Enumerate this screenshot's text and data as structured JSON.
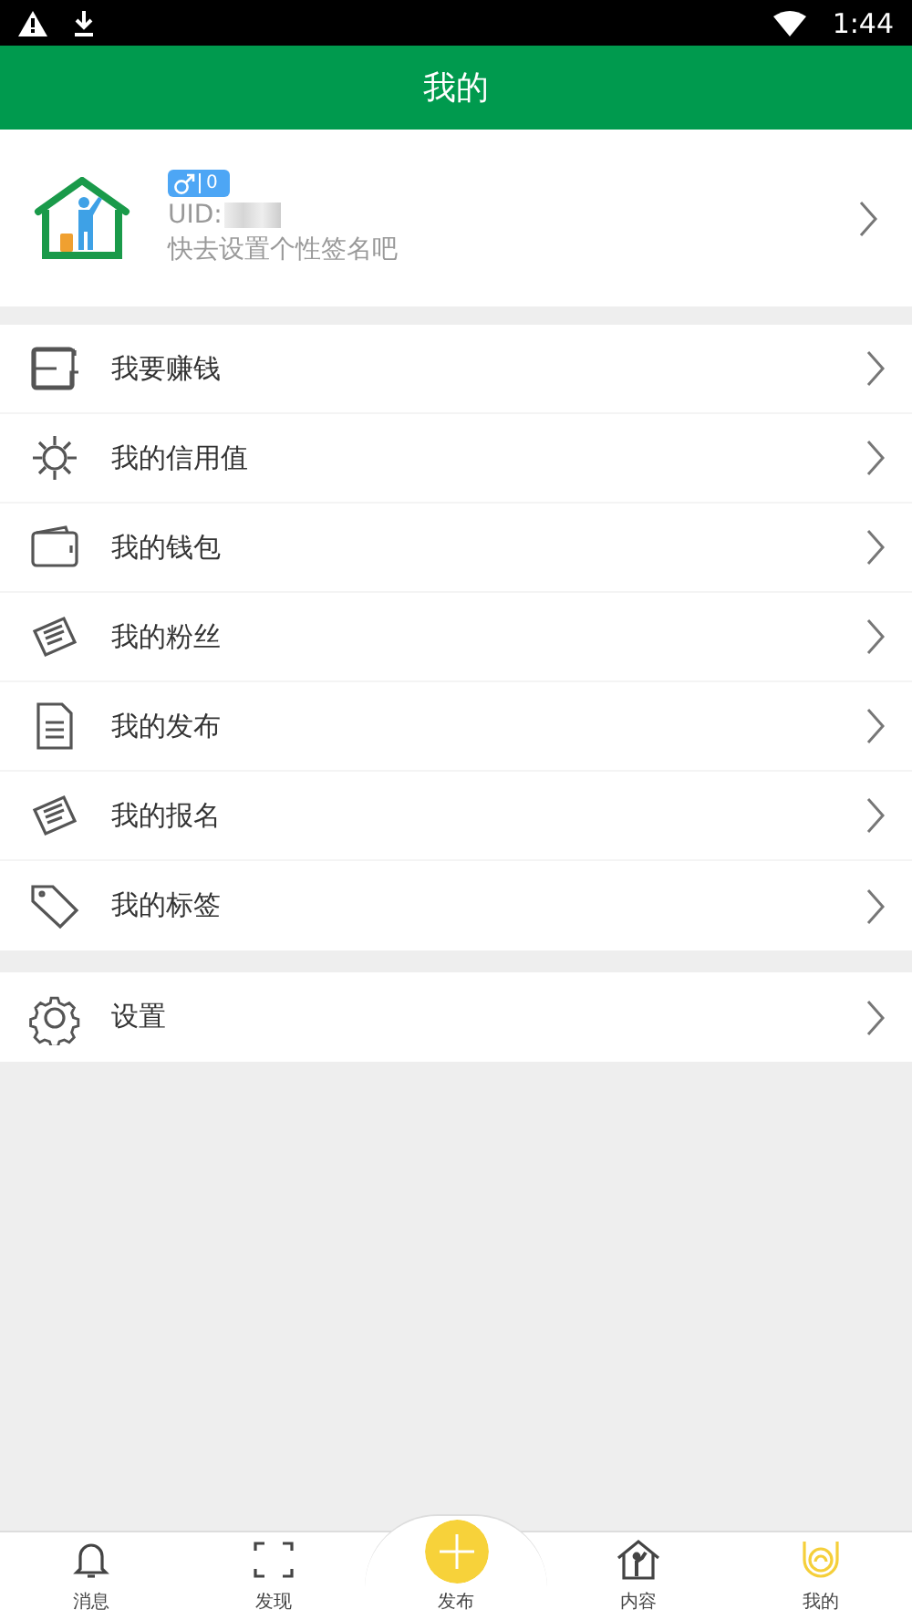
{
  "status_bar": {
    "time": "1:44"
  },
  "header": {
    "title": "我的"
  },
  "profile": {
    "badge_count": "0",
    "uid_label": "UID:",
    "signature": "快去设置个性签名吧"
  },
  "menu_sections": [
    [
      {
        "kind": "card",
        "label": "我要赚钱"
      },
      {
        "kind": "sun",
        "label": "我的信用值"
      },
      {
        "kind": "wallet",
        "label": "我的钱包"
      },
      {
        "kind": "note",
        "label": "我的粉丝"
      },
      {
        "kind": "document",
        "label": "我的发布"
      },
      {
        "kind": "note",
        "label": "我的报名"
      },
      {
        "kind": "tag",
        "label": "我的标签"
      }
    ],
    [
      {
        "kind": "gear",
        "label": "设置"
      }
    ]
  ],
  "tab_bar": [
    {
      "kind": "bell",
      "label": "消息",
      "selected": false
    },
    {
      "kind": "frame",
      "label": "发现",
      "selected": false
    },
    {
      "kind": "plus",
      "label": "发布",
      "selected": false
    },
    {
      "kind": "house",
      "label": "内容",
      "selected": false
    },
    {
      "kind": "face",
      "label": "我的",
      "selected": true
    }
  ]
}
